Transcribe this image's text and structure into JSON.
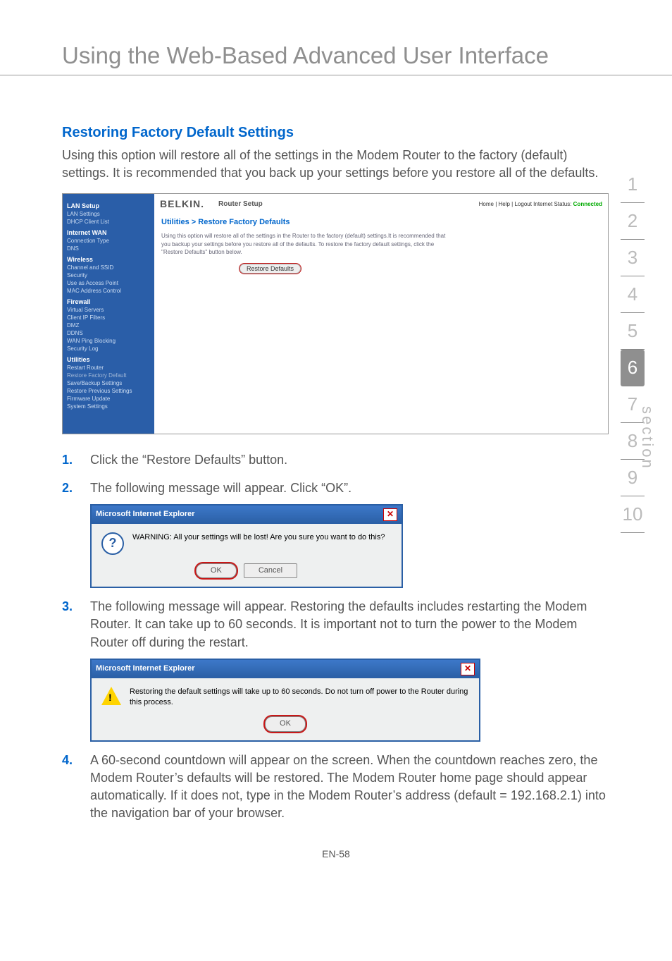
{
  "page_title": "Using the Web-Based Advanced User Interface",
  "section_heading": "Restoring Factory Default Settings",
  "intro": "Using this option will restore all of the settings in the Modem Router to the factory (default) settings. It is recommended that you back up your settings before you restore all of the defaults.",
  "router": {
    "logo": "BELKIN.",
    "top_title": "Router Setup",
    "top_links": "Home | Help | Logout   Internet Status:",
    "status_value": "Connected",
    "breadcrumb": "Utilities > Restore Factory Defaults",
    "description": "Using this option will restore all of the settings in the Router to the factory (default) settings.It is recommended that you backup your settings before you restore all of the defaults. To restore the factory default settings, click the \"Restore Defaults\" button below.",
    "restore_btn": "Restore Defaults",
    "sidebar": {
      "groups": [
        {
          "cat": "LAN Setup",
          "items": [
            "LAN Settings",
            "DHCP Client List"
          ]
        },
        {
          "cat": "Internet WAN",
          "items": [
            "Connection Type",
            "DNS"
          ]
        },
        {
          "cat": "Wireless",
          "items": [
            "Channel and SSID",
            "Security",
            "Use as Access Point",
            "MAC Address Control"
          ]
        },
        {
          "cat": "Firewall",
          "items": [
            "Virtual Servers",
            "Client IP Filters",
            "DMZ",
            "DDNS",
            "WAN Ping Blocking",
            "Security Log"
          ]
        },
        {
          "cat": "Utilities",
          "items": [
            "Restart Router",
            "Restore Factory Default",
            "Save/Backup Settings",
            "Restore Previous Settings",
            "Firmware Update",
            "System Settings"
          ]
        }
      ]
    }
  },
  "steps": [
    {
      "num": "1.",
      "text": "Click the “Restore Defaults” button."
    },
    {
      "num": "2.",
      "text": "The following message will appear. Click “OK”."
    },
    {
      "num": "3.",
      "text": "The following message will appear. Restoring the defaults includes restarting the Modem Router. It can take up to 60 seconds. It is important not to turn the power to the Modem Router off during the restart."
    },
    {
      "num": "4.",
      "text": "A 60-second countdown will appear on the screen. When the countdown reaches zero, the Modem Router’s defaults will be restored. The Modem Router home page should appear automatically. If it does not, type in the Modem Router’s address (default = 192.168.2.1) into the navigation bar of your browser."
    }
  ],
  "dialog1": {
    "title": "Microsoft Internet Explorer",
    "message": "WARNING: All your settings will be lost! Are you sure you want to do this?",
    "ok": "OK",
    "cancel": "Cancel"
  },
  "dialog2": {
    "title": "Microsoft Internet Explorer",
    "message": "Restoring the default settings will take up to 60 seconds. Do not turn off power to the Router during this process.",
    "ok": "OK"
  },
  "side_nav": {
    "label": "section",
    "items": [
      "1",
      "2",
      "3",
      "4",
      "5",
      "6",
      "7",
      "8",
      "9",
      "10"
    ],
    "active": "6"
  },
  "footer": "EN-58"
}
